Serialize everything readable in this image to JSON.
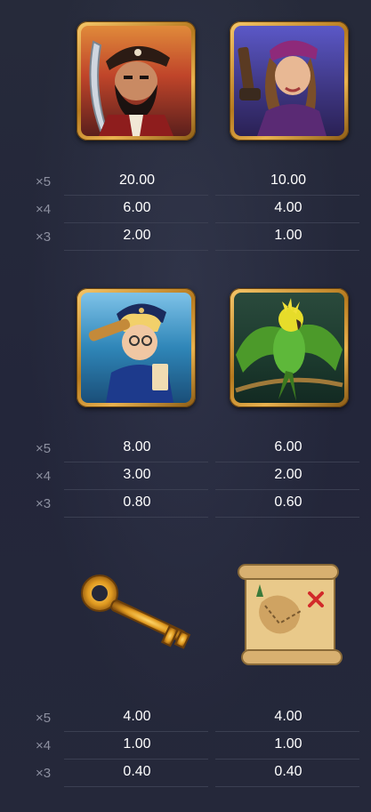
{
  "multipliers": [
    "×5",
    "×4",
    "×3"
  ],
  "symbols": [
    {
      "id": "pirate-captain",
      "payouts": [
        "20.00",
        "6.00",
        "2.00"
      ]
    },
    {
      "id": "pirate-woman",
      "payouts": [
        "10.00",
        "4.00",
        "1.00"
      ]
    },
    {
      "id": "sailor-boy",
      "payouts": [
        "8.00",
        "3.00",
        "0.80"
      ]
    },
    {
      "id": "parrot",
      "payouts": [
        "6.00",
        "2.00",
        "0.60"
      ]
    },
    {
      "id": "golden-key",
      "payouts": [
        "4.00",
        "1.00",
        "0.40"
      ]
    },
    {
      "id": "treasure-map",
      "payouts": [
        "4.00",
        "1.00",
        "0.40"
      ]
    }
  ],
  "colors": {
    "background": "#252838",
    "frame": "#e0a640",
    "label": "#8d90a0",
    "value": "#ffffff"
  }
}
